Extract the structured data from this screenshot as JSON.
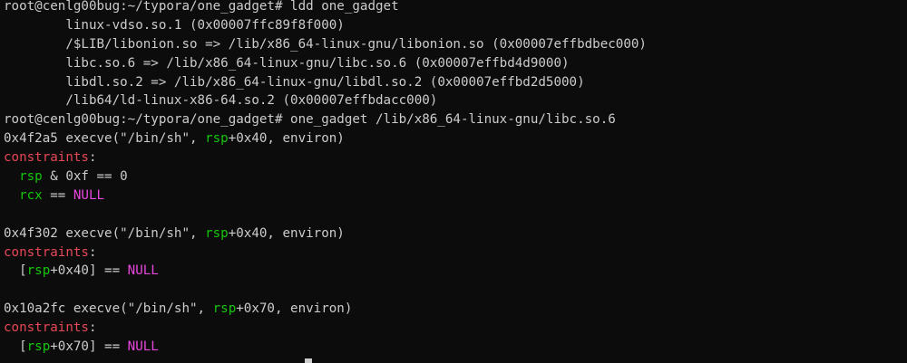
{
  "colors": {
    "background": "#0c0c0c",
    "default": "#cccccc",
    "red": "#e74856",
    "green": "#16c60c",
    "magenta": "#e847dc"
  },
  "terminal": {
    "lines": [
      [
        {
          "text": "root@cenlg00bug:~/typora/one_gadget# ldd one_gadget",
          "color": "default"
        }
      ],
      [
        {
          "text": "        linux-vdso.so.1 (0x00007ffc89f8f000)",
          "color": "default"
        }
      ],
      [
        {
          "text": "        /$LIB/libonion.so => /lib/x86_64-linux-gnu/libonion.so (0x00007effbdbec000)",
          "color": "default"
        }
      ],
      [
        {
          "text": "        libc.so.6 => /lib/x86_64-linux-gnu/libc.so.6 (0x00007effbd4d9000)",
          "color": "default"
        }
      ],
      [
        {
          "text": "        libdl.so.2 => /lib/x86_64-linux-gnu/libdl.so.2 (0x00007effbd2d5000)",
          "color": "default"
        }
      ],
      [
        {
          "text": "        /lib64/ld-linux-x86-64.so.2 (0x00007effbdacc000)",
          "color": "default"
        }
      ],
      [
        {
          "text": "root@cenlg00bug:~/typora/one_gadget# one_gadget /lib/x86_64-linux-gnu/libc.so.6",
          "color": "default"
        }
      ],
      [
        {
          "text": "0x4f2a5 execve(\"/bin/sh\", ",
          "color": "default"
        },
        {
          "text": "rsp",
          "color": "green"
        },
        {
          "text": "+0x40, environ)",
          "color": "default"
        }
      ],
      [
        {
          "text": "constraints",
          "color": "red"
        },
        {
          "text": ":",
          "color": "default"
        }
      ],
      [
        {
          "text": "  ",
          "color": "default"
        },
        {
          "text": "rsp",
          "color": "green"
        },
        {
          "text": " & 0xf == 0",
          "color": "default"
        }
      ],
      [
        {
          "text": "  ",
          "color": "default"
        },
        {
          "text": "rcx",
          "color": "green"
        },
        {
          "text": " == ",
          "color": "default"
        },
        {
          "text": "NULL",
          "color": "magenta"
        }
      ],
      [
        {
          "text": "",
          "color": "default"
        }
      ],
      [
        {
          "text": "0x4f302 execve(\"/bin/sh\", ",
          "color": "default"
        },
        {
          "text": "rsp",
          "color": "green"
        },
        {
          "text": "+0x40, environ)",
          "color": "default"
        }
      ],
      [
        {
          "text": "constraints",
          "color": "red"
        },
        {
          "text": ":",
          "color": "default"
        }
      ],
      [
        {
          "text": "  [",
          "color": "default"
        },
        {
          "text": "rsp",
          "color": "green"
        },
        {
          "text": "+0x40] == ",
          "color": "default"
        },
        {
          "text": "NULL",
          "color": "magenta"
        }
      ],
      [
        {
          "text": "",
          "color": "default"
        }
      ],
      [
        {
          "text": "0x10a2fc execve(\"/bin/sh\", ",
          "color": "default"
        },
        {
          "text": "rsp",
          "color": "green"
        },
        {
          "text": "+0x70, environ)",
          "color": "default"
        }
      ],
      [
        {
          "text": "constraints",
          "color": "red"
        },
        {
          "text": ":",
          "color": "default"
        }
      ],
      [
        {
          "text": "  [",
          "color": "default"
        },
        {
          "text": "rsp",
          "color": "green"
        },
        {
          "text": "+0x70] == ",
          "color": "default"
        },
        {
          "text": "NULL",
          "color": "magenta"
        }
      ]
    ]
  }
}
